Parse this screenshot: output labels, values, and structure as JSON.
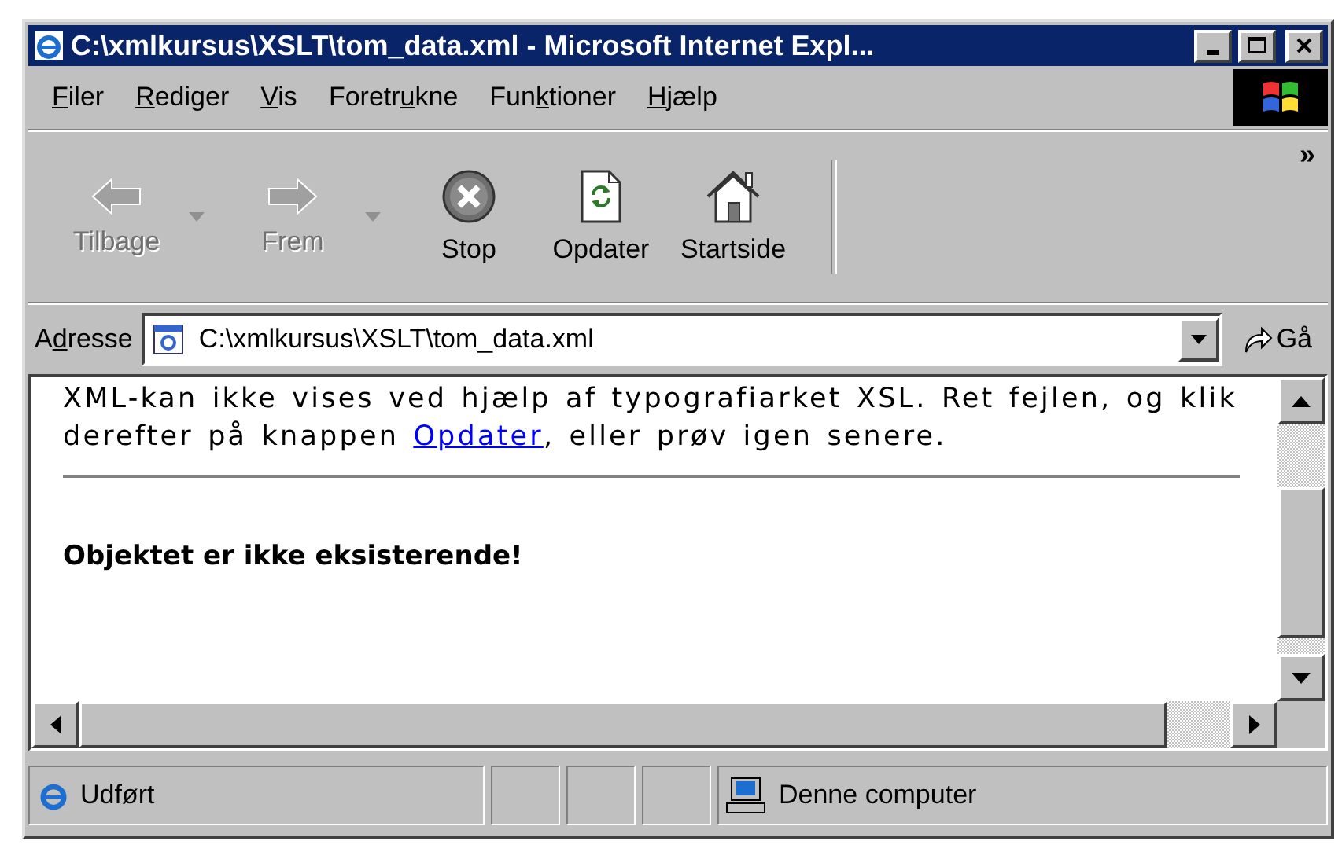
{
  "window": {
    "title": "C:\\xmlkursus\\XSLT\\tom_data.xml - Microsoft Internet Expl..."
  },
  "menu": [
    {
      "key": "F",
      "post": "iler"
    },
    {
      "key": "R",
      "post": "ediger"
    },
    {
      "key": "V",
      "post": "is"
    },
    {
      "pre": "Foretr",
      "key": "u",
      "post": "kne"
    },
    {
      "pre": "Fun",
      "key": "k",
      "post": "tioner"
    },
    {
      "key": "H",
      "post": "jælp"
    }
  ],
  "toolbar": {
    "buttons": [
      {
        "kind": "back",
        "label": "Tilbage",
        "disabled": true,
        "dropdown": true
      },
      {
        "kind": "forward",
        "label": "Frem",
        "disabled": true,
        "dropdown": true
      },
      {
        "kind": "stop",
        "label": "Stop",
        "disabled": false,
        "dropdown": false
      },
      {
        "kind": "refresh",
        "label": "Opdater",
        "disabled": false,
        "dropdown": false
      },
      {
        "kind": "home",
        "label": "Startside",
        "disabled": false,
        "dropdown": false
      }
    ],
    "overflow": "»"
  },
  "address_bar": {
    "label": {
      "pre": "A",
      "key": "d",
      "post": "resse"
    },
    "value": "C:\\xmlkursus\\XSLT\\tom_data.xml",
    "go": "Gå"
  },
  "content": {
    "paragraph": {
      "before": "XML-kan ikke vises ved hjælp af typografiarket XSL. Ret fejlen, og klik derefter på knappen ",
      "link": "Opdater",
      "after": ", eller prøv igen senere."
    },
    "error": "Objektet er ikke eksisterende!"
  },
  "status_bar": {
    "text": "Udført",
    "zone": "Denne computer"
  }
}
